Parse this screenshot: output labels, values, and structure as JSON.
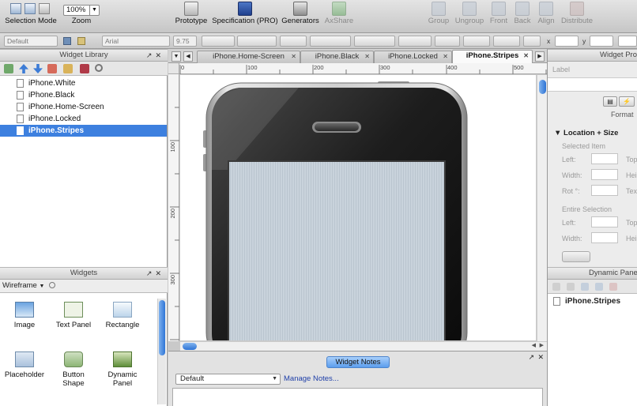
{
  "toolbar": {
    "selection_mode": "Selection Mode",
    "zoom_value": "100%",
    "zoom_label": "Zoom",
    "prototype": "Prototype",
    "specification": "Specification (PRO)",
    "generators": "Generators",
    "axshare": "AxShare",
    "group": "Group",
    "ungroup": "Ungroup",
    "front": "Front",
    "back": "Back",
    "align": "Align",
    "distribute": "Distribute"
  },
  "formatbar": {
    "style_value": "Default",
    "font_value": "Arial",
    "size_value": "9.75",
    "x_label": "x",
    "y_label": "y"
  },
  "widget_library": {
    "title": "Widget Library",
    "items": [
      {
        "label": "iPhone.White",
        "selected": false
      },
      {
        "label": "iPhone.Black",
        "selected": false
      },
      {
        "label": "iPhone.Home-Screen",
        "selected": false
      },
      {
        "label": "iPhone.Locked",
        "selected": false
      },
      {
        "label": "iPhone.Stripes",
        "selected": true
      }
    ]
  },
  "widgets": {
    "title": "Widgets",
    "filter": "Wireframe",
    "tiles": [
      {
        "label": "Image",
        "icon": "image-icon"
      },
      {
        "label": "Text Panel",
        "icon": "text-panel-icon"
      },
      {
        "label": "Rectangle",
        "icon": "rectangle-icon"
      },
      {
        "label": "Placeholder",
        "icon": "placeholder-icon"
      },
      {
        "label": "Button Shape",
        "icon": "button-shape-icon"
      },
      {
        "label": "Dynamic Panel",
        "icon": "dynamic-panel-icon"
      }
    ]
  },
  "tabs": [
    {
      "label": "iPhone.Home-Screen",
      "active": false
    },
    {
      "label": "iPhone.Black",
      "active": false
    },
    {
      "label": "iPhone.Locked",
      "active": false
    },
    {
      "label": "iPhone.Stripes",
      "active": true
    }
  ],
  "ruler": {
    "top": [
      "0",
      "100",
      "200",
      "300",
      "400",
      "500"
    ],
    "left": [
      "100",
      "200",
      "300"
    ]
  },
  "notes": {
    "button": "Widget Notes",
    "select_value": "Default",
    "manage": "Manage Notes..."
  },
  "properties": {
    "title": "Widget Pro",
    "label_field": "Label",
    "format_tab": "Format",
    "location_size": "Location + Size",
    "selected_item": "Selected Item",
    "left": "Left:",
    "top": "Top",
    "width": "Width:",
    "height": "Hei",
    "rot": "Rot °:",
    "text": "Tex",
    "entire_selection": "Entire Selection",
    "left2": "Left:",
    "top2": "Top",
    "width2": "Width:",
    "height2": "Hei"
  },
  "dynamic_panel": {
    "title": "Dynamic Pane",
    "item": "iPhone.Stripes"
  },
  "colors": {
    "selection": "#3d80df",
    "screen": "#c7d1da",
    "phone_bezel": "#121212"
  }
}
